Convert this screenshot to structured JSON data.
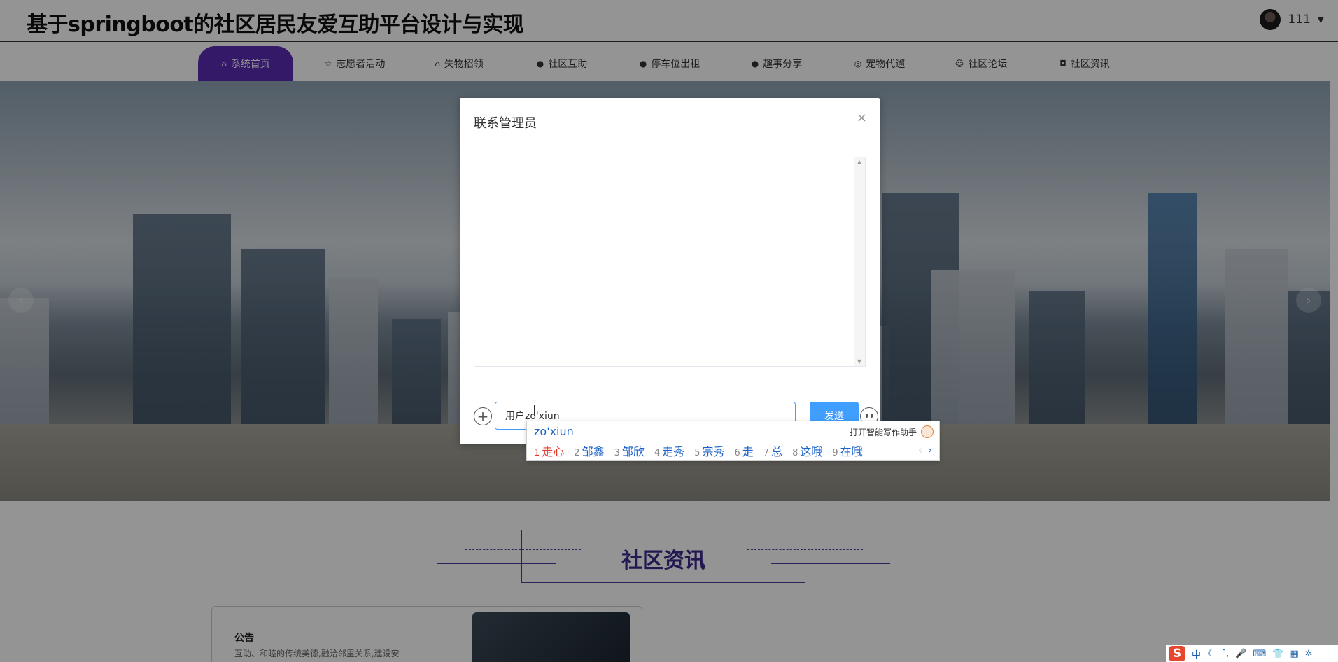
{
  "header": {
    "site_title": "基于springboot的社区居民友爱互助平台设计与实现",
    "username": "111",
    "caret": "▼"
  },
  "nav": {
    "items": [
      {
        "label": "系统首页",
        "icon": "⌂",
        "icon_name": "home-icon",
        "active": true
      },
      {
        "label": "志愿者活动",
        "icon": "☆",
        "icon_name": "star-icon"
      },
      {
        "label": "失物招领",
        "icon": "⌂",
        "icon_name": "bag-icon"
      },
      {
        "label": "社区互助",
        "icon": "●",
        "icon_name": "info-icon"
      },
      {
        "label": "停车位出租",
        "icon": "●",
        "icon_name": "help-icon"
      },
      {
        "label": "趣事分享",
        "icon": "●",
        "icon_name": "info-icon"
      },
      {
        "label": "宠物代遛",
        "icon": "◎",
        "icon_name": "pet-icon"
      },
      {
        "label": "社区论坛",
        "icon": "☺",
        "icon_name": "forum-icon"
      },
      {
        "label": "社区资讯",
        "icon": "◘",
        "icon_name": "camera-icon"
      }
    ]
  },
  "banner": {
    "prev_arrow": "‹",
    "next_arrow": "›"
  },
  "section": {
    "title": "社区资讯"
  },
  "notice": {
    "title": "公告",
    "text": "互助、和睦的传统美德,融洽邻里关系,建设安"
  },
  "modal": {
    "title": "联系管理员",
    "close": "×",
    "input_value": "用户zo'xiun",
    "send_label": "发送",
    "add_symbol": "+"
  },
  "ime": {
    "pinyin": "zo'xiun",
    "assistant": "打开智能写作助手",
    "candidates": [
      {
        "num": "1",
        "text": "走心"
      },
      {
        "num": "2",
        "text": "邹鑫"
      },
      {
        "num": "3",
        "text": "邹欣"
      },
      {
        "num": "4",
        "text": "走秀"
      },
      {
        "num": "5",
        "text": "宗秀"
      },
      {
        "num": "6",
        "text": "走"
      },
      {
        "num": "7",
        "text": "总"
      },
      {
        "num": "8",
        "text": "这哦"
      },
      {
        "num": "9",
        "text": "在哦"
      }
    ],
    "pager_prev": "‹",
    "pager_next": "›"
  },
  "taskbar": {
    "logo": "S",
    "lang": "中",
    "moon": "☾",
    "punct": "°,",
    "mic": "🎤",
    "keyboard": "⌨",
    "shirt": "👕",
    "grid": "▦",
    "gear": "✲"
  }
}
